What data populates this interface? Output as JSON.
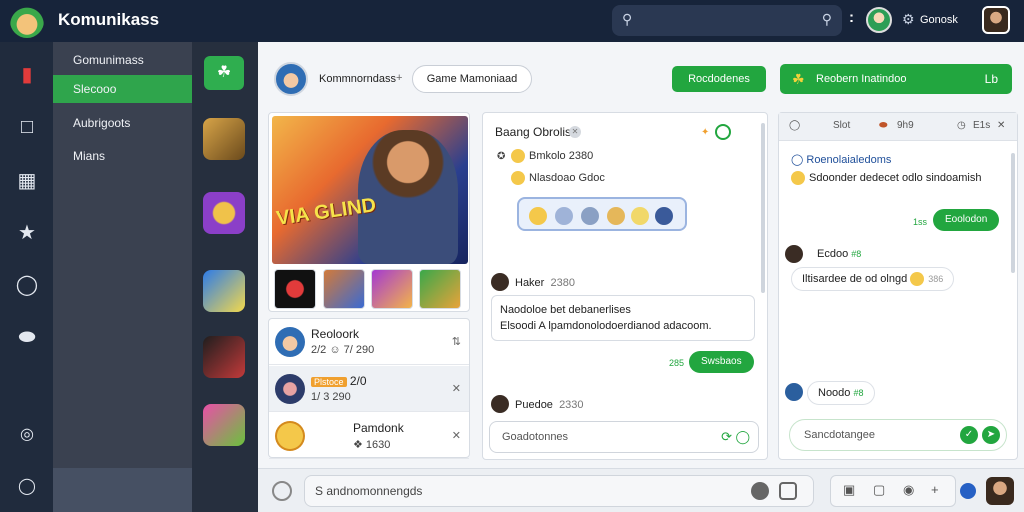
{
  "app": {
    "title": "Komunikass",
    "user_name": "Gonosk"
  },
  "nav": {
    "items": [
      {
        "label": "Gomunimass",
        "active": false
      },
      {
        "label": "Slecooo",
        "active": true
      },
      {
        "label": "Aubrigoots",
        "active": false
      },
      {
        "label": "Mians",
        "active": false
      }
    ]
  },
  "header": {
    "contact_name": "Kommnorndass",
    "plus": "+",
    "pill_label": "Game Mamoniaad",
    "button1_label": "Rocdodenes",
    "button2_label": "Reobern Inatindoo",
    "button2_icon": "Lb"
  },
  "chat_list": [
    {
      "name": "Reoloork",
      "meta": "2/2 ☺ 7/ 290"
    },
    {
      "name": "",
      "badge": "Plstoce",
      "badge_extra": "2/0",
      "meta": "1/ 3 290"
    },
    {
      "name": "Pamdonk",
      "meta": "❖ 1630"
    }
  ],
  "chat": {
    "title": "Baang Obrolis",
    "line1": "Bmkolo 2380",
    "line2": "Nlasdoao Gdoc",
    "msg1_name": "Haker",
    "msg1_time": "2380",
    "msg1_text_1": "Naodoloe bet debanerlises",
    "msg1_text_2": "Elsoodi A lpamdonolodoerdianod adacoom.",
    "msg1_reply_label": "285",
    "msg1_reply": "Swsbaos",
    "msg2_name": "Puedoe",
    "msg2_time": "2330",
    "input_placeholder": "Goadotonnes"
  },
  "side": {
    "tabs": [
      "Slot",
      "9h9",
      "E1s"
    ],
    "title": "Roenolaialedoms",
    "subtitle": "Sdoonder dedecet odlo sindoamish",
    "reply1_label": "1ss",
    "reply1": "Eoolodon",
    "bubble1_name": "Ecdoo",
    "bubble1_tag": "#8",
    "bubble2": "Iltisardee de od olngd",
    "bubble2_tag": "386",
    "bubble3": "Noodo",
    "bubble3_tag": "#8",
    "reply_placeholder": "Sancdotangee"
  },
  "composer": {
    "placeholder": "S andnomonnengds"
  },
  "colors": {
    "topbar": "#17243a",
    "accent_green": "#22a63f",
    "nav_active": "#2fa54c"
  },
  "icons": {
    "rail": [
      "card-icon",
      "square-icon",
      "grid-icon",
      "star-icon",
      "chat-icon",
      "shield-icon",
      "settings-icon",
      "power-icon"
    ],
    "hero_image_text": "VIA GLIND"
  }
}
